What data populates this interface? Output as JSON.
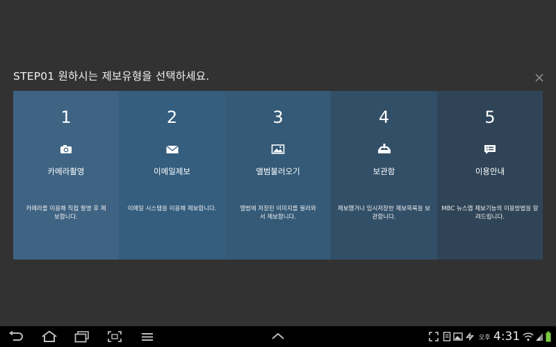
{
  "dialog": {
    "title": "STEP01 원하시는 제보유형을 선택하세요.",
    "options": [
      {
        "number": "1",
        "icon": "camera-icon",
        "label": "카메라촬영",
        "description": "카메라를 이용해 직접 촬영 후 제보합니다."
      },
      {
        "number": "2",
        "icon": "email-icon",
        "label": "이메일제보",
        "description": "이메일 시스템을 이용해 제보합니다."
      },
      {
        "number": "3",
        "icon": "photo-album-icon",
        "label": "앨범불러오기",
        "description": "앨범에 저장된 이미지를 불러와서 제보합니다."
      },
      {
        "number": "4",
        "icon": "inbox-icon",
        "label": "보관함",
        "description": "제보했거나 임시저장한 제보목록을 보관합니다."
      },
      {
        "number": "5",
        "icon": "info-chat-icon",
        "label": "이용안내",
        "description": "MBC 뉴스앱 제보기능의 이용방법을 알려드립니다."
      }
    ],
    "card_colors": [
      "#3f6383",
      "#345d7e",
      "#345a77",
      "#324f68",
      "#2f4457"
    ]
  },
  "system_bar": {
    "ampm": "오후",
    "time": "4:31"
  }
}
